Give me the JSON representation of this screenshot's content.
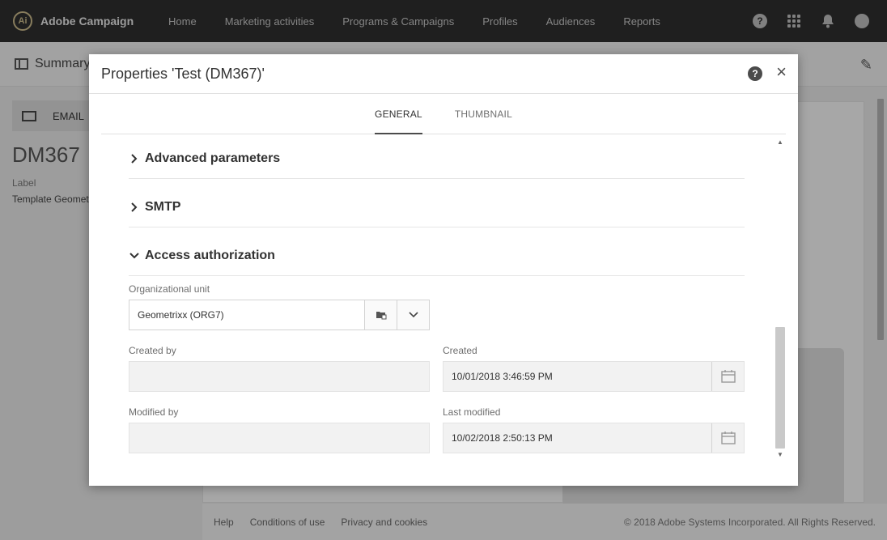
{
  "app": {
    "name": "Adobe Campaign",
    "logo_glyph": "Ai"
  },
  "nav": {
    "items": [
      "Home",
      "Marketing activities",
      "Programs & Campaigns",
      "Profiles",
      "Audiences",
      "Reports"
    ]
  },
  "top_icons": {
    "help": "?",
    "apps": "apps-grid-icon",
    "notifications": "bell-icon",
    "profile": "avatar-icon"
  },
  "page": {
    "header_title": "Summary",
    "channel": "EMAIL",
    "code": "DM367",
    "label_caption": "Label",
    "label_value": "Template Geomet"
  },
  "footer": {
    "links": [
      "Help",
      "Conditions of use",
      "Privacy and cookies"
    ],
    "copyright": "© 2018 Adobe Systems Incorporated. All Rights Reserved."
  },
  "modal": {
    "title": "Properties 'Test (DM367)'",
    "help_glyph": "?",
    "close_glyph": "×",
    "tabs": [
      {
        "label": "GENERAL",
        "active": true
      },
      {
        "label": "THUMBNAIL",
        "active": false
      }
    ],
    "sections": [
      {
        "title": "Advanced parameters",
        "expanded": false
      },
      {
        "title": "SMTP",
        "expanded": false
      },
      {
        "title": "Access authorization",
        "expanded": true
      }
    ],
    "fields": {
      "org_unit_label": "Organizational unit",
      "org_unit_value": "Geometrixx (ORG7)",
      "created_by_label": "Created by",
      "created_by_value": "",
      "created_label": "Created",
      "created_value": "10/01/2018 3:46:59 PM",
      "modified_by_label": "Modified by",
      "modified_by_value": "",
      "last_modified_label": "Last modified",
      "last_modified_value": "10/02/2018 2:50:13 PM"
    },
    "scroll": {
      "up": "▲",
      "down": "▼"
    }
  },
  "colors": {
    "topbar": "#2f2f2f",
    "accent_logo": "#c9b98a",
    "text_primary": "#323232",
    "text_muted": "#6e6e6e"
  }
}
